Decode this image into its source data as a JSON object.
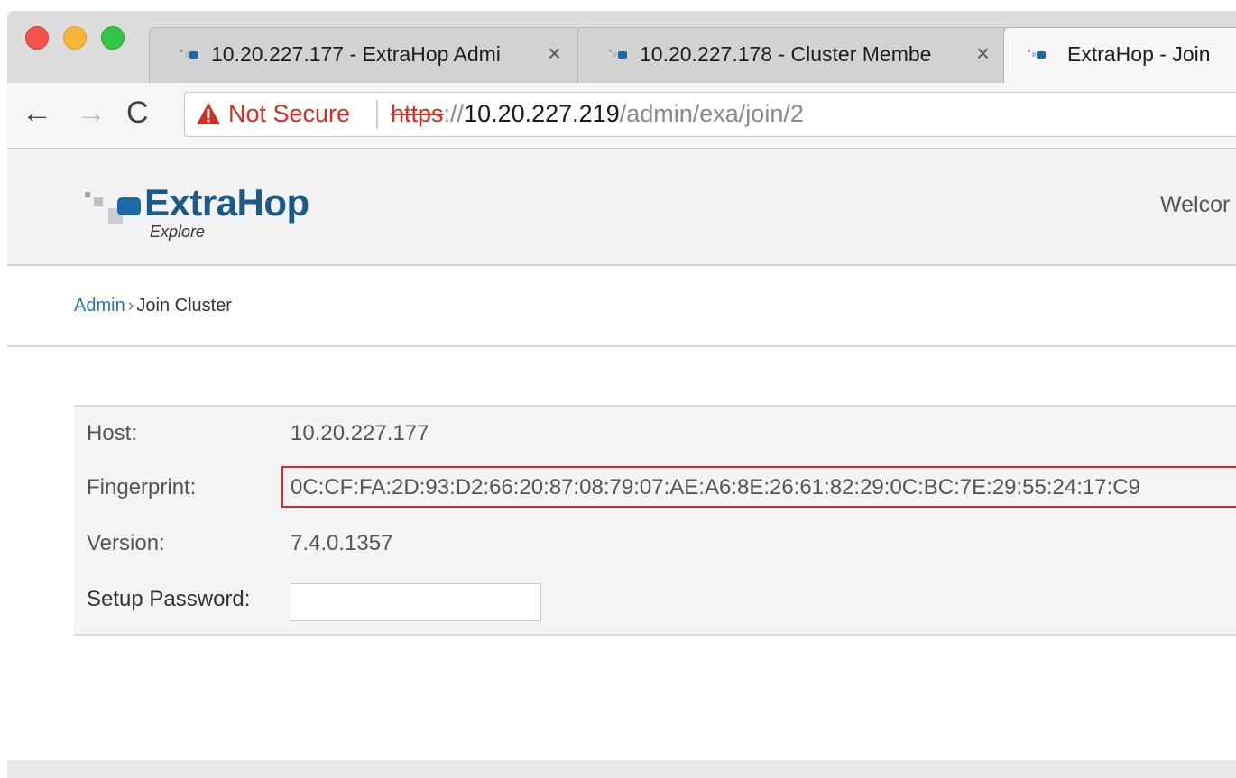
{
  "browser": {
    "tabs": [
      {
        "title": "10.20.227.177 - ExtraHop Admi",
        "close": "×",
        "active": false
      },
      {
        "title": "10.20.227.178 - Cluster Membe",
        "close": "×",
        "active": false
      },
      {
        "title": "ExtraHop - Join",
        "active": true
      }
    ],
    "nav": {
      "back": "←",
      "forward": "→",
      "reload": "C"
    },
    "address": {
      "security_label": "Not Secure",
      "scheme": "https",
      "scheme_sep": "://",
      "host": "10.20.227.219",
      "path": "/admin/exa/join/2"
    },
    "colors": {
      "warning": "#d32e24",
      "traffic_red": "#f4544c",
      "traffic_yellow": "#f6b63a",
      "traffic_green": "#36c44a"
    }
  },
  "header": {
    "logo_text": "ExtraHop",
    "logo_subtitle": "Explore",
    "welcome": "Welcor",
    "brand_color": "#1b5a86"
  },
  "breadcrumb": {
    "root": "Admin",
    "separator": "›",
    "current": "Join Cluster"
  },
  "form": {
    "host_label": "Host:",
    "host_value": "10.20.227.177",
    "fingerprint_label": "Fingerprint:",
    "fingerprint_value": "0C:CF:FA:2D:93:D2:66:20:87:08:79:07:AE:A6:8E:26:61:82:29:0C:BC:7E:29:55:24:17:C9",
    "version_label": "Version:",
    "version_value": "7.4.0.1357",
    "password_label": "Setup Password:",
    "password_value": ""
  },
  "icons": {
    "warning": "warning-triangle-icon",
    "favicon": "extrahop-favicon-icon"
  }
}
